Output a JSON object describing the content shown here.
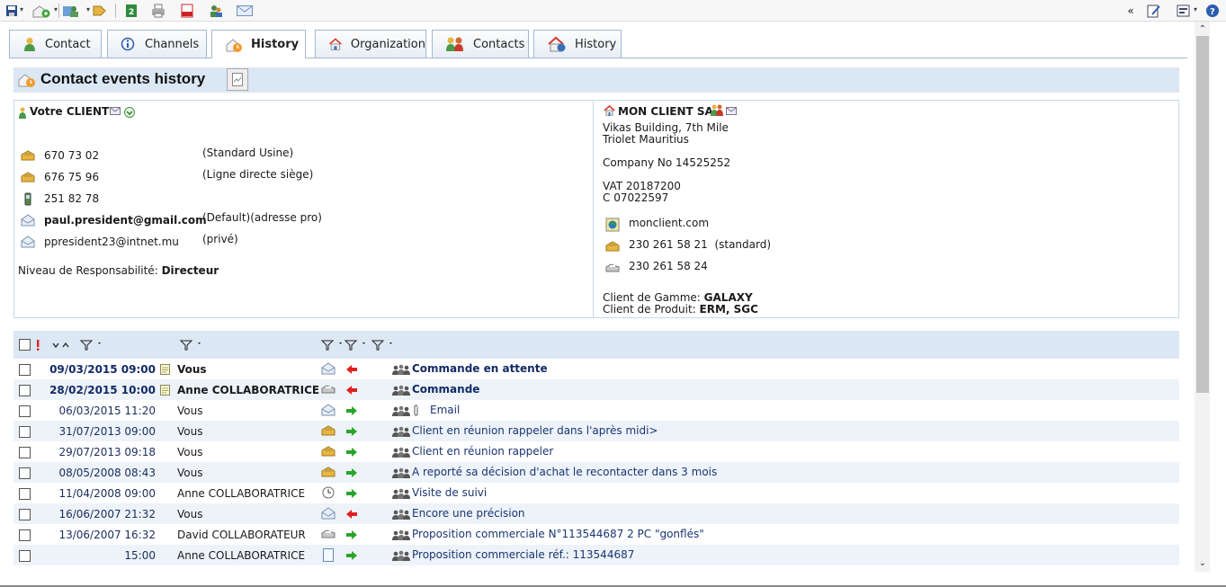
{
  "tabs": [
    {
      "label": "Contact"
    },
    {
      "label": "Channels"
    },
    {
      "label": "History"
    },
    {
      "label": "Organization"
    },
    {
      "label": "Contacts"
    },
    {
      "label": "History"
    }
  ],
  "section": {
    "title": "Contact events history"
  },
  "contact": {
    "name": "Votre CLIENT",
    "phones": [
      {
        "number": "670 73 02",
        "note": "(Standard Usine)"
      },
      {
        "number": "676 75 96",
        "note": "(Ligne directe siège)"
      },
      {
        "number": "251 82 78",
        "note": ""
      }
    ],
    "emails": [
      {
        "address": "paul.president@gmail.com",
        "note": "(Default)(adresse pro)"
      },
      {
        "address": "ppresident23@intnet.mu",
        "note": "(privé)"
      }
    ],
    "level_label": "Niveau de Responsabilité:",
    "level_value": "Directeur"
  },
  "company": {
    "name": "MON CLIENT SA",
    "address1": "Vikas Building, 7th Mile",
    "address2": "Triolet Mauritius",
    "company_no": "Company No 14525252",
    "vat": "VAT 20187200",
    "c": "C 07022597",
    "website": "monclient.com",
    "phone": "230 261 58 21",
    "phone_note": "(standard)",
    "fax": "230 261 58 24",
    "gamme_label": "Client de Gamme:",
    "gamme_value": "GALAXY",
    "produit_label": "Client de Produit:",
    "produit_value": "ERM, SGC"
  },
  "history": [
    {
      "date": "09/03/2015 09:00",
      "who": "Vous",
      "subject": "Commande en attente",
      "bold": true,
      "has_note": true,
      "type_icon": "email",
      "direction": "in",
      "attach": false
    },
    {
      "date": "28/02/2015 10:00",
      "who": "Anne COLLABORATRICE",
      "subject": "Commande",
      "bold": true,
      "has_note": true,
      "type_icon": "fax",
      "direction": "in",
      "attach": false
    },
    {
      "date": "06/03/2015 11:20",
      "who": "Vous",
      "subject": "Email",
      "bold": false,
      "has_note": false,
      "type_icon": "email",
      "direction": "out",
      "attach": true
    },
    {
      "date": "31/07/2013 09:00",
      "who": "Vous",
      "subject": "Client en réunion rappeler dans l'après midi>",
      "bold": false,
      "has_note": false,
      "type_icon": "phone",
      "direction": "out",
      "attach": false
    },
    {
      "date": "29/07/2013 09:18",
      "who": "Vous",
      "subject": "Client en réunion rappeler",
      "bold": false,
      "has_note": false,
      "type_icon": "phone",
      "direction": "out",
      "attach": false
    },
    {
      "date": "08/05/2008 08:43",
      "who": "Vous",
      "subject": "A reporté sa décision d'achat le recontacter dans 3 mois",
      "bold": false,
      "has_note": false,
      "type_icon": "phone",
      "direction": "out",
      "attach": false
    },
    {
      "date": "11/04/2008 09:00",
      "who": "Anne COLLABORATRICE",
      "subject": "Visite de suivi",
      "bold": false,
      "has_note": false,
      "type_icon": "visit",
      "direction": "out",
      "attach": false
    },
    {
      "date": "16/06/2007 21:32",
      "who": "Vous",
      "subject": "Encore une précision",
      "bold": false,
      "has_note": false,
      "type_icon": "email",
      "direction": "in",
      "attach": false
    },
    {
      "date": "13/06/2007 16:32",
      "who": "David COLLABORATEUR",
      "subject": "Proposition commerciale N°113544687 2 PC \"gonflés\"",
      "bold": false,
      "has_note": false,
      "type_icon": "fax",
      "direction": "out",
      "attach": false
    },
    {
      "date": "15:00",
      "who": "Anne COLLABORATRICE",
      "subject": "Proposition commerciale réf.: 113544687",
      "bold": false,
      "has_note": false,
      "type_icon": "document",
      "direction": "out",
      "attach": false
    }
  ],
  "colors": {
    "accent": "#dbe7f3",
    "link": "#1a3572",
    "arrow_in": "#e02020",
    "arrow_out": "#2aa52a"
  }
}
